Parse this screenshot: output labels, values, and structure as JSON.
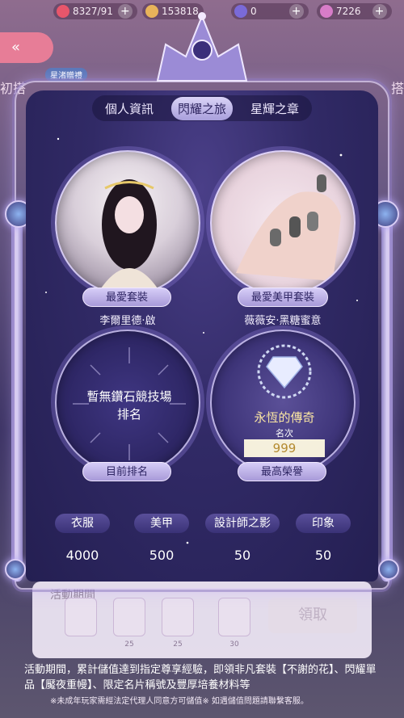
{
  "resources": [
    {
      "icon": "heart-icon",
      "value": "8327/91",
      "color": "#e8566b"
    },
    {
      "icon": "cat-icon",
      "value": "153818",
      "color": "#e8b35a"
    },
    {
      "icon": "gem-icon",
      "value": "0",
      "color": "#7a6ad8"
    },
    {
      "icon": "diamond-icon",
      "value": "7226",
      "color": "#d77cc8"
    }
  ],
  "background": {
    "tag": "星渚贈禮",
    "left_fragment": "初搭",
    "right_fragment": "搭"
  },
  "tabs": [
    {
      "label": "個人資訊",
      "active": false
    },
    {
      "label": "閃耀之旅",
      "active": true
    },
    {
      "label": "星輝之章",
      "active": false
    }
  ],
  "cards": {
    "favorite_outfit": {
      "label": "最愛套裝",
      "name": "李爾里德·啟"
    },
    "favorite_nail": {
      "label": "最愛美甲套裝",
      "name": "薇薇安·黑糖蜜意"
    },
    "current_rank": {
      "label": "目前排名",
      "text_line1": "暫無鑽石競技場",
      "text_line2": "排名"
    },
    "highest_honor": {
      "label": "最高榮譽",
      "title": "永恆的傳奇",
      "subtitle": "名次",
      "value": "999"
    }
  },
  "stats": [
    {
      "label": "衣服",
      "value": "4000"
    },
    {
      "label": "美甲",
      "value": "500"
    },
    {
      "label": "設計師之影",
      "value": "50"
    },
    {
      "label": "印象",
      "value": "50"
    }
  ],
  "activity": {
    "title": "活動期間",
    "claim_label": "領取",
    "item_counts": [
      "",
      "25",
      "25",
      "30"
    ],
    "description": "活動期間，累計儲值達到指定尊享經驗，即領非凡套裝【不謝的花】、閃耀單品【魘夜重幔】、限定名片稱號及豐厚培養材料等",
    "note": "※未成年玩家需經法定代理人同意方可儲值※ 如遇儲值問題請聯繫客服。"
  }
}
